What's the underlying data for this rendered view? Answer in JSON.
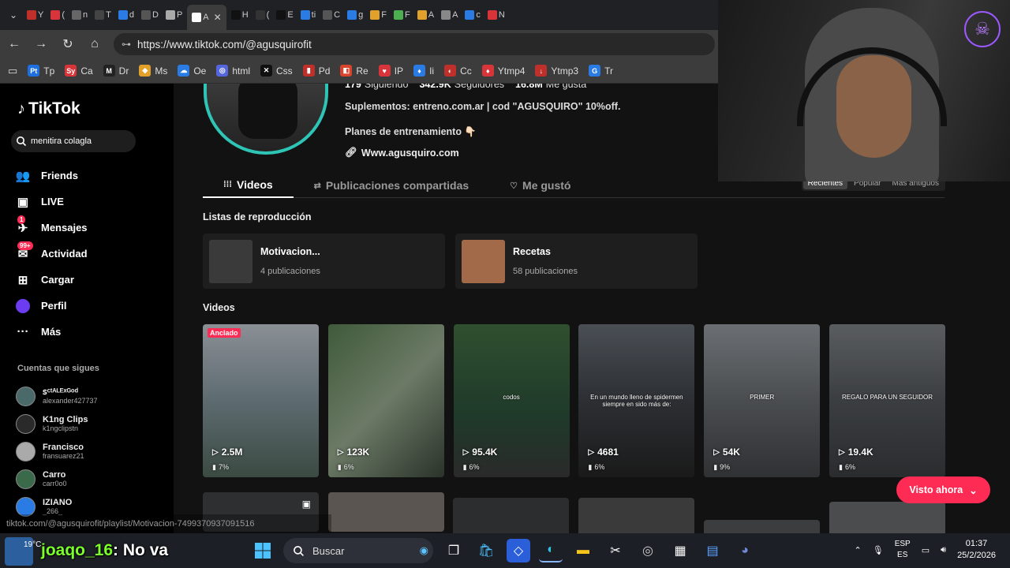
{
  "browser": {
    "tab_labels": [
      "Y",
      "(",
      "n",
      "T",
      "d",
      "D",
      "P",
      "A",
      "H",
      "(",
      "E",
      "ti",
      "C",
      "g",
      "F",
      "F",
      "A",
      "A",
      "c",
      "N"
    ],
    "url": "https://www.tiktok.com/@agusquirofit",
    "bookmarks": [
      {
        "label": "Tp",
        "icon": "Pt",
        "color": "#1e6fe0"
      },
      {
        "label": "Ca",
        "icon": "Sy",
        "color": "#d8353b"
      },
      {
        "label": "Dr",
        "icon": "M",
        "color": "#222"
      },
      {
        "label": "Ms",
        "icon": "◆",
        "color": "#e2a12b"
      },
      {
        "label": "Oe",
        "icon": "☁",
        "color": "#2a7be4"
      },
      {
        "label": "html",
        "icon": "◎",
        "color": "#5566dd"
      },
      {
        "label": "Css",
        "icon": "✕",
        "color": "#111"
      },
      {
        "label": "Pd",
        "icon": "▮",
        "color": "#c0302b"
      },
      {
        "label": "Re",
        "icon": "◧",
        "color": "#d9442c"
      },
      {
        "label": "IP",
        "icon": "♥",
        "color": "#d8353b"
      },
      {
        "label": "Ii",
        "icon": "♦",
        "color": "#2a7be4"
      },
      {
        "label": "Cc",
        "icon": "◐",
        "color": "#c0302b"
      },
      {
        "label": "Ytmp4",
        "icon": "♦",
        "color": "#d8353b"
      },
      {
        "label": "Ytmp3",
        "icon": "↓",
        "color": "#c0302b"
      },
      {
        "label": "Tr",
        "icon": "G",
        "color": "#2a7be4"
      }
    ]
  },
  "sidebar": {
    "logo": "TikTok",
    "search_value": "menitira colagla",
    "nav": [
      {
        "label": "Friends",
        "icon": "friends-icon",
        "glyph": "👥"
      },
      {
        "label": "LIVE",
        "icon": "live-icon",
        "glyph": "▣"
      },
      {
        "label": "Mensajes",
        "icon": "messages-icon",
        "glyph": "✈",
        "badge": "1"
      },
      {
        "label": "Actividad",
        "icon": "activity-icon",
        "glyph": "✉",
        "badge": "99+"
      },
      {
        "label": "Cargar",
        "icon": "upload-icon",
        "glyph": "⊞"
      },
      {
        "label": "Perfil",
        "icon": "profile-icon",
        "glyph": "●"
      },
      {
        "label": "Más",
        "icon": "more-icon",
        "glyph": "···"
      }
    ],
    "following_header": "Cuentas que sigues",
    "following": [
      {
        "name": "ꜱᶜᵗᴬᴸᴱˣᴳᵒᵈ",
        "user": "alexander427737"
      },
      {
        "name": "K1ng Clips",
        "user": "k1ngclipstn"
      },
      {
        "name": "Francisco",
        "user": "fransuarez21"
      },
      {
        "name": "Carro",
        "user": "carr0o0"
      },
      {
        "name": "IZIANO",
        "user": "_266_"
      }
    ]
  },
  "profile": {
    "following_count": "179",
    "following_label": "Siguiendo",
    "followers_count": "342.9K",
    "followers_label": "Seguidores",
    "likes_count": "16.8M",
    "likes_label": "Me gusta",
    "bio_line1": "Suplementos: entreno.com.ar | cod \"AGUSQUIRO\" 10%off.",
    "bio_line2": "Planes de entrenamiento 👇🏻",
    "link": "Www.agusquiro.com"
  },
  "tabs": [
    {
      "label": "Videos",
      "active": true,
      "glyph": "⁞⁞⁞"
    },
    {
      "label": "Publicaciones compartidas",
      "active": false,
      "glyph": "⇄"
    },
    {
      "label": "Me gustó",
      "active": false,
      "glyph": "♡"
    }
  ],
  "sort": [
    "Recientes",
    "Popular",
    "Más antiguos"
  ],
  "playlists_title": "Listas de reproducción",
  "playlists": [
    {
      "title": "Motivacion...",
      "count": "4 publicaciones",
      "color": "#3a3a3a"
    },
    {
      "title": "Recetas",
      "count": "58 publicaciones",
      "color": "#a36a4a"
    }
  ],
  "videos_title": "Videos",
  "videos": [
    {
      "views": "2.5M",
      "pct": "7%",
      "pinned": "Anclado",
      "bg": "linear-gradient(#8a8f95, #5d6b70 50%, #3b4a42)"
    },
    {
      "views": "123K",
      "pct": "6%",
      "bg": "linear-gradient(135deg, #3f5a3a, #6c7a66 50%, #2a332a)"
    },
    {
      "views": "95.4K",
      "pct": "6%",
      "caption": "codos",
      "bg": "linear-gradient(#2f4f2f, #1f3a2a 60%, #2a2a2a)"
    },
    {
      "views": "4681",
      "pct": "6%",
      "caption": "En un mundo lleno de spidermen siempre en sido más de:",
      "bg": "linear-gradient(#4a4f55, #2c2f33 50%, #1a1a1a)"
    },
    {
      "views": "54K",
      "pct": "9%",
      "caption": "PRIMER",
      "bg": "linear-gradient(#6b6f73, #4a4d50 50%, #2f3133)"
    },
    {
      "views": "19.4K",
      "pct": "6%",
      "caption": "REGALO PARA UN SEGUIDOR",
      "bg": "linear-gradient(#5a5d60, #3b3e41 50%, #2a2c2e)"
    }
  ],
  "visto_ahora": "Visto ahora",
  "status_url": "tiktok.com/@agusquirofit/playlist/Motivacion-7499370937091516",
  "overlay": {
    "chat_user": "joaqo_16",
    "chat_text": ": No va",
    "temp": "19°C"
  },
  "taskbar": {
    "search_placeholder": "Buscar",
    "lang_top": "ESP",
    "lang_bottom": "ES",
    "time": "01:37",
    "date": "25/2/2026"
  }
}
